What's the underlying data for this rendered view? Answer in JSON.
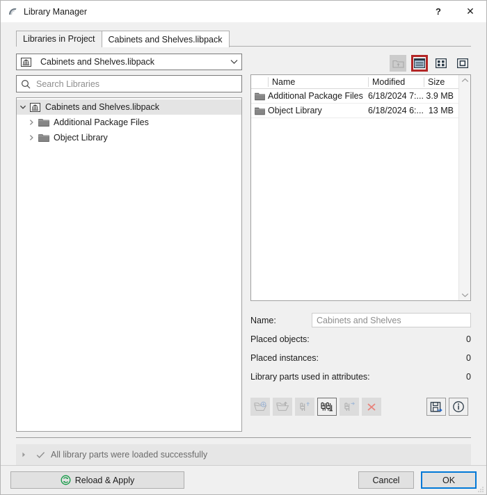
{
  "window": {
    "title": "Library Manager",
    "icon": "arc-logo-icon",
    "help_label": "?",
    "close_label": "✕"
  },
  "tabs": [
    {
      "label": "Libraries in Project",
      "active": false
    },
    {
      "label": "Cabinets and Shelves.libpack",
      "active": true
    }
  ],
  "left_panel": {
    "combo": {
      "value": "Cabinets and Shelves.libpack",
      "icon": "libpack-icon",
      "arrow_icon": "chevron-down-icon"
    },
    "search": {
      "placeholder": "Search Libraries",
      "value": "",
      "icon": "search-icon"
    },
    "tree": [
      {
        "label": "Cabinets and Shelves.libpack",
        "icon": "libpack-icon",
        "twisty": "chevron-down-icon",
        "selected": true,
        "indent": 0
      },
      {
        "label": "Additional Package Files",
        "icon": "folder-icon",
        "twisty": "chevron-right-icon",
        "selected": false,
        "indent": 1
      },
      {
        "label": "Object Library",
        "icon": "folder-icon",
        "twisty": "chevron-right-icon",
        "selected": false,
        "indent": 1
      }
    ]
  },
  "view_toolbar": [
    {
      "name": "go-up-folder-button",
      "icon": "folder-up-icon",
      "state": "disabled",
      "selected": false
    },
    {
      "name": "list-view-button",
      "icon": "list-view-icon",
      "state": "enabled",
      "selected": true
    },
    {
      "name": "grid-view-button",
      "icon": "grid-view-icon",
      "state": "enabled",
      "selected": false
    },
    {
      "name": "large-icon-view-button",
      "icon": "large-icon-view-icon",
      "state": "enabled",
      "selected": false
    }
  ],
  "file_list": {
    "columns": [
      "Name",
      "Modified",
      "Size"
    ],
    "rows": [
      {
        "name": "Additional Package Files",
        "modified": "6/18/2024 7:...",
        "size": "3.9 MB",
        "icon": "folder-icon"
      },
      {
        "name": "Object Library",
        "modified": "6/18/2024 6:...",
        "size": "13 MB",
        "icon": "folder-icon"
      }
    ],
    "scroll_up_icon": "chevron-up-icon",
    "scroll_down_icon": "chevron-down-icon"
  },
  "info_panel": {
    "name_label": "Name:",
    "name_value": "Cabinets and Shelves",
    "rows": [
      {
        "label": "Placed objects:",
        "value": "0"
      },
      {
        "label": "Placed instances:",
        "value": "0"
      },
      {
        "label": "Library parts used in attributes:",
        "value": "0"
      }
    ]
  },
  "action_toolbar": {
    "left": [
      {
        "name": "add-library-button",
        "icon": "folder-add-icon",
        "state": "disabled"
      },
      {
        "name": "export-library-button",
        "icon": "folder-export-icon",
        "state": "disabled"
      },
      {
        "name": "export-object-button",
        "icon": "chair-export-icon",
        "state": "disabled"
      },
      {
        "name": "duplicate-object-button",
        "icon": "chair-duplicate-icon",
        "state": "enabled"
      },
      {
        "name": "move-object-button",
        "icon": "chair-move-icon",
        "state": "disabled"
      },
      {
        "name": "delete-object-button",
        "icon": "delete-x-icon",
        "state": "disabled"
      }
    ],
    "right": [
      {
        "name": "save-as-button",
        "icon": "save-as-icon",
        "state": "enabled"
      },
      {
        "name": "info-button",
        "icon": "info-circle-icon",
        "state": "enabled"
      }
    ]
  },
  "status_bar": {
    "expand_icon": "chevron-right-icon",
    "check_icon": "check-icon",
    "message": "All library parts were loaded successfully"
  },
  "footer": {
    "reload_label": "Reload & Apply",
    "reload_icon": "refresh-icon",
    "cancel_label": "Cancel",
    "ok_label": "OK"
  },
  "colors": {
    "accent_selected": "#b32626",
    "focus_blue": "#0078d7",
    "reload_green": "#119944",
    "delete_red": "#e8827a",
    "window_bg": "#f0f0f0"
  }
}
